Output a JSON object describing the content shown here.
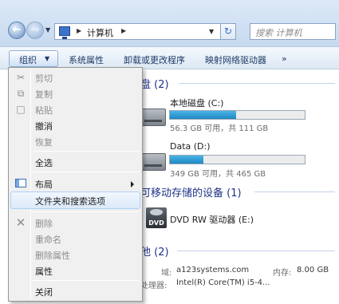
{
  "address_bar": {
    "breadcrumb": [
      "计算机"
    ],
    "search_placeholder": "搜索 计算机"
  },
  "toolbar": {
    "organize_label": "组织",
    "items": [
      "系统属性",
      "卸载或更改程序",
      "映射网络驱动器",
      "»"
    ]
  },
  "content": {
    "groups": [
      {
        "header": "硬盘 (2)"
      },
      {
        "header": "有可移动存储的设备 (1)"
      },
      {
        "header": "其他 (2)"
      }
    ],
    "drives": [
      {
        "name": "本地磁盘 (C:)",
        "space": "56.3 GB 可用，共 111 GB",
        "used_fraction": 0.49
      },
      {
        "name": "Data (D:)",
        "space": "349 GB 可用，共 465 GB",
        "used_fraction": 0.25
      }
    ],
    "removable": [
      {
        "name": "DVD RW 驱动器 (E:)",
        "icon": "dvd-drive-icon",
        "icon_text": "DVD"
      }
    ]
  },
  "status_bar": {
    "domain_label": "域:",
    "domain_value": "a123systems.com",
    "memory_label": "内存:",
    "memory_value": "8.00 GB",
    "processor_label": "处理器:",
    "processor_value": "Intel(R) Core(TM) i5-4..."
  },
  "organize_menu": {
    "items": [
      {
        "label": "剪切",
        "enabled": false,
        "icon": "scissors-icon"
      },
      {
        "label": "复制",
        "enabled": false,
        "icon": "copy-icon"
      },
      {
        "label": "粘贴",
        "enabled": false,
        "icon": "paste-icon"
      },
      {
        "label": "撤消",
        "enabled": true
      },
      {
        "label": "恢复",
        "enabled": false
      },
      {
        "label": "全选",
        "enabled": true
      },
      {
        "label": "布局",
        "enabled": true,
        "icon": "layout-icon",
        "submenu": true
      },
      {
        "label": "文件夹和搜索选项",
        "enabled": true,
        "highlighted": true
      },
      {
        "label": "删除",
        "enabled": false,
        "icon": "delete-icon"
      },
      {
        "label": "重命名",
        "enabled": false
      },
      {
        "label": "删除属性",
        "enabled": false
      },
      {
        "label": "属性",
        "enabled": true
      },
      {
        "label": "关闭",
        "enabled": true
      }
    ]
  },
  "colors": {
    "group_header": "#1e3287",
    "drive_bar_fill": "#26a0da",
    "menu_highlight": "#dbe9f9"
  }
}
